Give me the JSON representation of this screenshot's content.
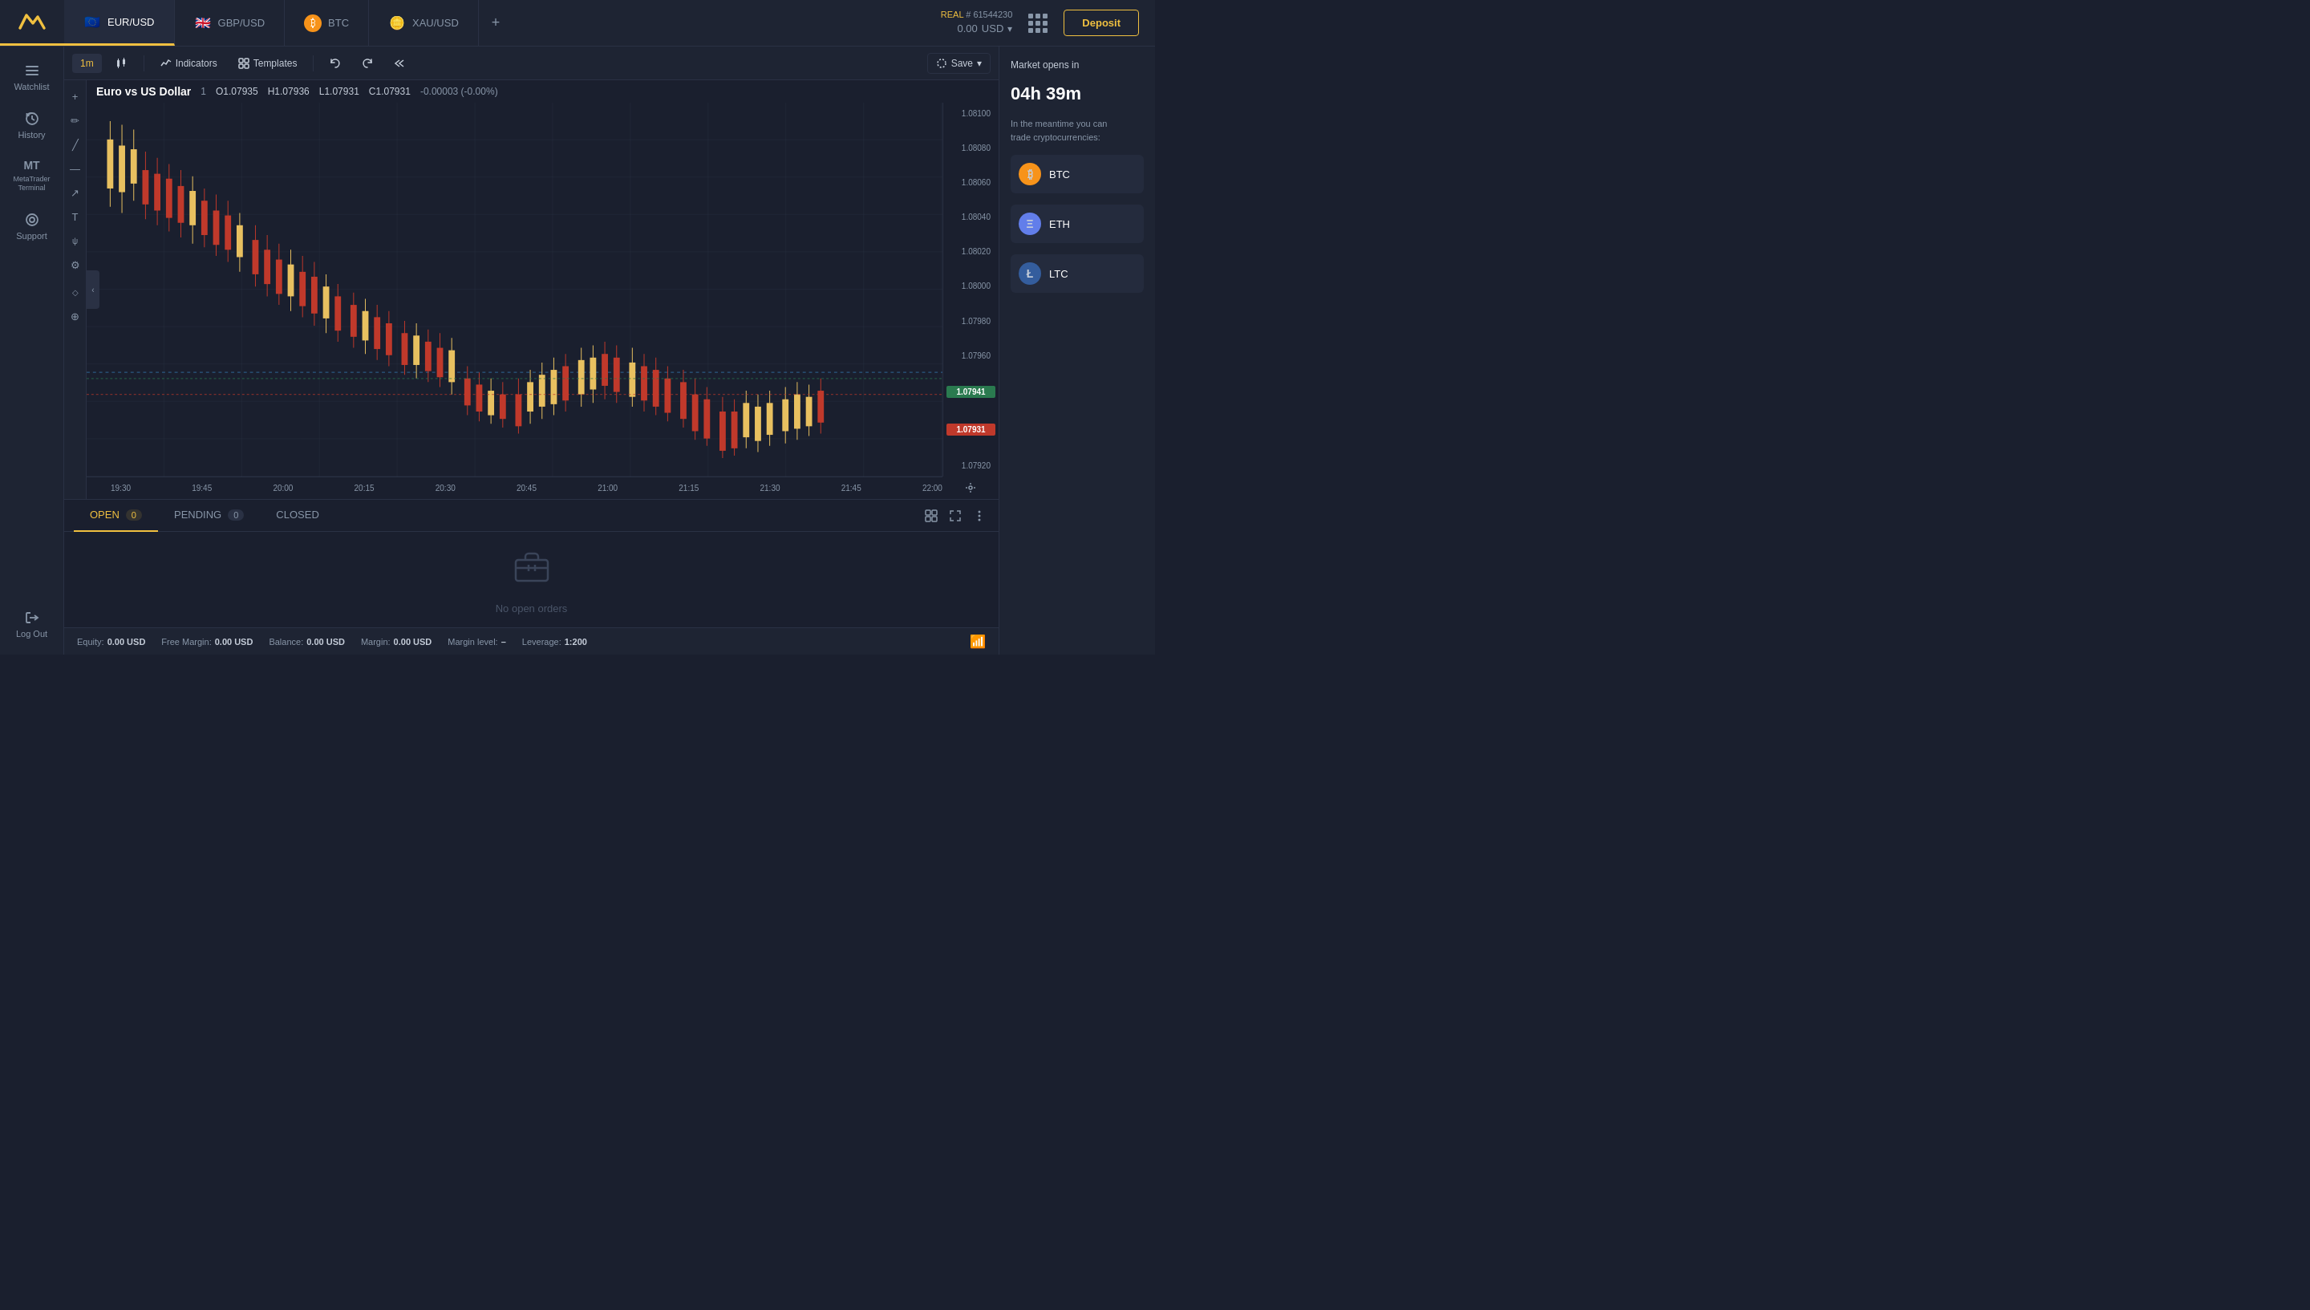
{
  "header": {
    "logo_alt": "Exness Logo",
    "account_type": "REAL",
    "account_id": "# 61544230",
    "balance": "0.00",
    "currency": "USD",
    "deposit_label": "Deposit"
  },
  "tabs": [
    {
      "id": "eur-usd",
      "label": "EUR/USD",
      "flag": "🇪🇺",
      "active": true
    },
    {
      "id": "gbp-usd",
      "label": "GBP/USD",
      "flag": "🇬🇧",
      "active": false
    },
    {
      "id": "btc",
      "label": "BTC",
      "flag": "₿",
      "active": false
    },
    {
      "id": "xau-usd",
      "label": "XAU/USD",
      "flag": "🪙",
      "active": false
    }
  ],
  "sidebar": {
    "items": [
      {
        "id": "watchlist",
        "icon": "☰",
        "label": "Watchlist"
      },
      {
        "id": "history",
        "icon": "⟳",
        "label": "History"
      },
      {
        "id": "metatrader",
        "icon": "MT",
        "label": "MetaTrader Terminal"
      },
      {
        "id": "support",
        "icon": "💬",
        "label": "Support"
      },
      {
        "id": "logout",
        "icon": "⎋",
        "label": "Log Out"
      }
    ]
  },
  "toolbar": {
    "timeframe": "1m",
    "indicators_label": "Indicators",
    "templates_label": "Templates",
    "save_label": "Save"
  },
  "chart": {
    "symbol": "Euro vs US Dollar",
    "timeframe_display": "1",
    "ohlc": {
      "open_label": "O",
      "open": "1.07935",
      "high_label": "H",
      "high": "1.07936",
      "low_label": "L",
      "low": "1.07931",
      "close_label": "C",
      "close": "1.07931",
      "change": "-0.00003",
      "change_pct": "-0.00%"
    },
    "price_levels": [
      "1.08100",
      "1.08080",
      "1.08060",
      "1.08040",
      "1.08020",
      "1.08000",
      "1.07980",
      "1.07960",
      "1.07941",
      "1.07931",
      "1.07920"
    ],
    "time_labels": [
      "19:30",
      "19:45",
      "20:00",
      "20:15",
      "20:30",
      "20:45",
      "21:00",
      "21:15",
      "21:30",
      "21:45",
      "22:00"
    ],
    "badge_green": "1.07941",
    "badge_red": "1.07931"
  },
  "market_panel": {
    "opens_label": "Market opens in",
    "opens_time": "04h 39m",
    "desc_line1": "In the meantime you can",
    "desc_line2": "trade cryptocurrencies:",
    "cryptos": [
      {
        "id": "btc",
        "symbol": "BTC",
        "icon": "₿",
        "class": "btc"
      },
      {
        "id": "eth",
        "symbol": "ETH",
        "icon": "Ξ",
        "class": "eth"
      },
      {
        "id": "ltc",
        "symbol": "LTC",
        "icon": "Ł",
        "class": "ltc"
      }
    ]
  },
  "orders": {
    "tabs": [
      {
        "id": "open",
        "label": "OPEN",
        "count": "0",
        "active": true
      },
      {
        "id": "pending",
        "label": "PENDING",
        "count": "0",
        "active": false
      },
      {
        "id": "closed",
        "label": "CLOSED",
        "count": null,
        "active": false
      }
    ],
    "empty_text": "No open orders"
  },
  "footer": {
    "equity_label": "Equity:",
    "equity": "0.00 USD",
    "free_margin_label": "Free Margin:",
    "free_margin": "0.00 USD",
    "balance_label": "Balance:",
    "balance": "0.00 USD",
    "margin_label": "Margin:",
    "margin": "0.00 USD",
    "margin_level_label": "Margin level:",
    "margin_level": "–",
    "leverage_label": "Leverage:",
    "leverage": "1:200"
  }
}
